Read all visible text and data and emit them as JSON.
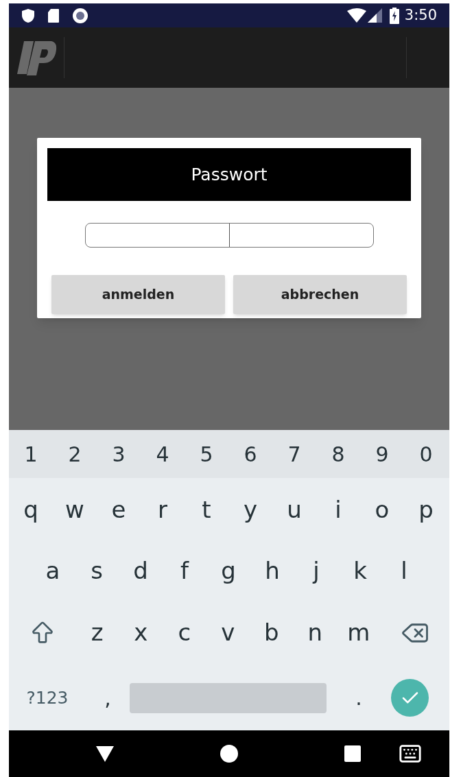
{
  "status_bar": {
    "time": "3:50"
  },
  "dialog": {
    "title": "Passwort",
    "buttons": [
      "anmelden",
      "abbrechen"
    ]
  },
  "keyboard": {
    "number_row": [
      "1",
      "2",
      "3",
      "4",
      "5",
      "6",
      "7",
      "8",
      "9",
      "0"
    ],
    "letter_rows": [
      [
        "q",
        "w",
        "e",
        "r",
        "t",
        "y",
        "u",
        "i",
        "o",
        "p"
      ],
      [
        "a",
        "s",
        "d",
        "f",
        "g",
        "h",
        "j",
        "k",
        "l"
      ],
      [
        "z",
        "x",
        "c",
        "v",
        "b",
        "n",
        "m"
      ]
    ],
    "bottom_row": {
      "symbols_key": "?123",
      "comma_key": ",",
      "period_key": "."
    }
  }
}
